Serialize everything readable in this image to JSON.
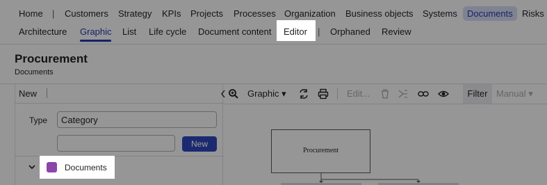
{
  "nav": {
    "primary": [
      "Home",
      "Customers",
      "Strategy",
      "KPIs",
      "Projects",
      "Processes",
      "Organization",
      "Business objects",
      "Systems",
      "Documents",
      "Risks"
    ],
    "primary_active": "Documents",
    "secondary": [
      "Architecture",
      "Graphic",
      "List",
      "Life cycle",
      "Document content",
      "Editor",
      "Orphaned",
      "Review"
    ],
    "secondary_active": "Graphic"
  },
  "header": {
    "title": "Procurement",
    "subtitle": "Documents"
  },
  "left": {
    "new_label": "New",
    "type_label": "Type",
    "type_value": "Category",
    "new_button": "New",
    "tree_item": "Documents"
  },
  "right": {
    "view_select": "Graphic",
    "edit_label": "Edit...",
    "filter_label": "Filter",
    "manual_label": "Manual"
  },
  "diagram": {
    "node_label": "Procurement"
  },
  "colors": {
    "accent": "#2637a8",
    "primary_button": "#2d44b5",
    "category_swatch": "#8c45a9"
  }
}
